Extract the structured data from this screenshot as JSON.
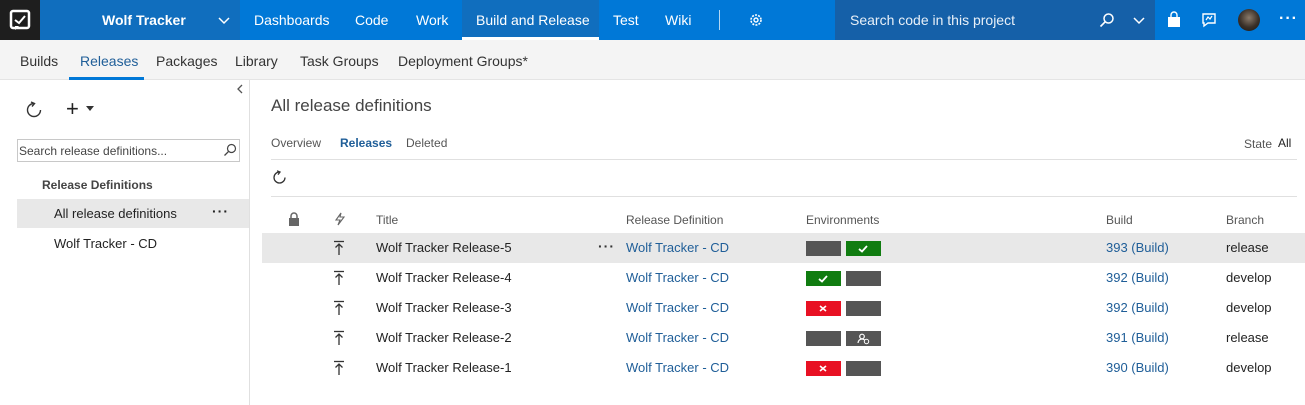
{
  "topbar": {
    "project_name": "Wolf Tracker",
    "nav": [
      "Dashboards",
      "Code",
      "Work",
      "Build and Release",
      "Test",
      "Wiki"
    ],
    "search_placeholder": "Search code in this project"
  },
  "subnav": {
    "items": [
      "Builds",
      "Releases",
      "Packages",
      "Library",
      "Task Groups",
      "Deployment Groups*"
    ],
    "active": "Releases"
  },
  "sidebar": {
    "search_placeholder": "Search release definitions...",
    "heading": "Release Definitions",
    "items": [
      "All release definitions",
      "Wolf Tracker - CD"
    ],
    "selected": "All release definitions"
  },
  "main": {
    "title": "All release definitions",
    "pivots": [
      "Overview",
      "Releases",
      "Deleted"
    ],
    "active_pivot": "Releases",
    "state_label": "State",
    "state_value": "All"
  },
  "table": {
    "columns": {
      "title": "Title",
      "definition": "Release Definition",
      "environments": "Environments",
      "build": "Build",
      "branch": "Branch"
    },
    "rows": [
      {
        "title": "Wolf Tracker Release-5",
        "definition": "Wolf Tracker - CD",
        "env": [
          "not-deployed",
          "succeeded"
        ],
        "build": "393 (Build)",
        "branch": "release",
        "selected": true
      },
      {
        "title": "Wolf Tracker Release-4",
        "definition": "Wolf Tracker - CD",
        "env": [
          "succeeded",
          "not-deployed"
        ],
        "build": "392 (Build)",
        "branch": "develop"
      },
      {
        "title": "Wolf Tracker Release-3",
        "definition": "Wolf Tracker - CD",
        "env": [
          "failed",
          "not-deployed"
        ],
        "build": "392 (Build)",
        "branch": "develop"
      },
      {
        "title": "Wolf Tracker Release-2",
        "definition": "Wolf Tracker - CD",
        "env": [
          "not-deployed",
          "pending-approval"
        ],
        "build": "391 (Build)",
        "branch": "release"
      },
      {
        "title": "Wolf Tracker Release-1",
        "definition": "Wolf Tracker - CD",
        "env": [
          "failed",
          "not-deployed"
        ],
        "build": "390 (Build)",
        "branch": "develop"
      }
    ]
  },
  "colors": {
    "brand": "#0078d7",
    "link": "#1f5e98",
    "succeeded": "#107c10",
    "failed": "#e81123",
    "neutral": "#555555"
  }
}
